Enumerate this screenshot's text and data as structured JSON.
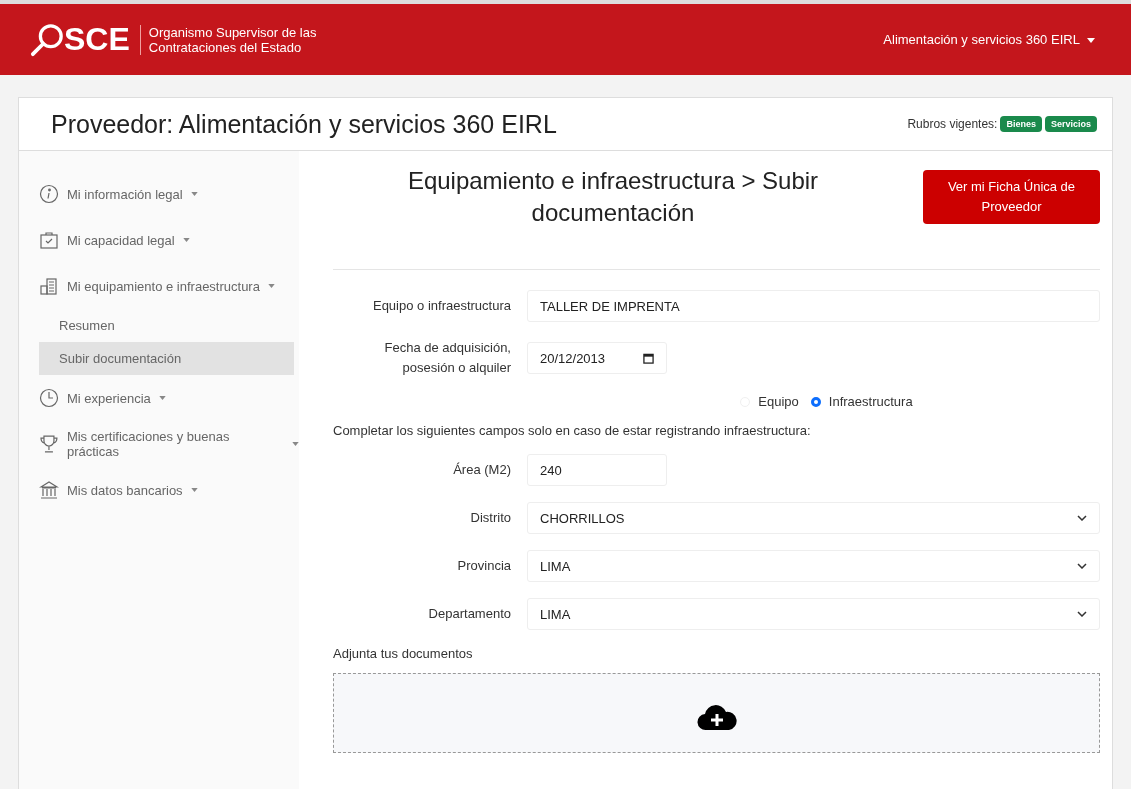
{
  "header": {
    "logo": "SCE",
    "org_line_1": "Organismo Supervisor de las",
    "org_line_2": "Contrataciones del Estado",
    "user": "Alimentación y servicios 360 EIRL"
  },
  "title": "Proveedor: Alimentación y servicios 360 EIRL",
  "rubros": {
    "label": "Rubros vigentes:",
    "tags": [
      "Bienes",
      "Servicios"
    ]
  },
  "sidebar": {
    "items": [
      {
        "label": "Mi información legal"
      },
      {
        "label": "Mi capacidad legal"
      },
      {
        "label": "Mi equipamiento e infraestructura",
        "children": [
          {
            "label": "Resumen",
            "selected": false
          },
          {
            "label": "Subir documentación",
            "selected": true
          }
        ]
      },
      {
        "label": "Mi experiencia"
      },
      {
        "label": "Mis certificaciones y buenas prácticas"
      },
      {
        "label": "Mis datos bancarios"
      }
    ]
  },
  "heading": "Equipamiento e infraestructura > Subir documentación",
  "ficha_button": "Ver mi Ficha Única de Proveedor",
  "fields_top": [
    {
      "kind": "text",
      "label": "Equipo o infraestructura",
      "value": "TALLER DE IMPRENTA"
    },
    {
      "kind": "date",
      "label": "Fecha de adquisición, posesión o alquiler",
      "value": "20/12/2013"
    }
  ],
  "radios": [
    {
      "label": "Equipo",
      "selected": false
    },
    {
      "label": "Infraestructura",
      "selected": true
    }
  ],
  "note": "Completar los siguientes campos solo en caso de estar registrando infraestructura:",
  "fields_bottom": [
    {
      "kind": "short",
      "label": "Área (M2)",
      "value": "240"
    },
    {
      "kind": "select",
      "label": "Distrito",
      "value": "CHORRILLOS"
    },
    {
      "kind": "select",
      "label": "Provincia",
      "value": "LIMA"
    },
    {
      "kind": "select",
      "label": "Departamento",
      "value": "LIMA"
    }
  ],
  "attach_label": "Adjunta tus documentos"
}
